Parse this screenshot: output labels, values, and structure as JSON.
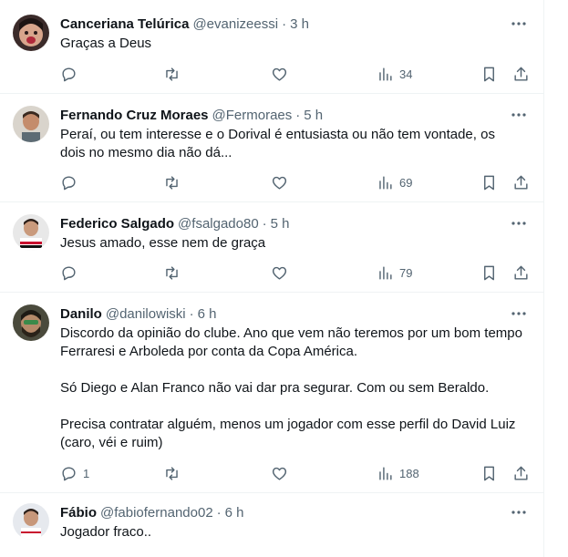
{
  "tweets": [
    {
      "name": "Canceriana Telúrica",
      "handle": "@evanizeessi",
      "separator": "·",
      "time": "3 h",
      "text": [
        "Graças a Deus"
      ],
      "replies": "",
      "views": "34",
      "avatar_icon": "avatar-face-icon"
    },
    {
      "name": "Fernando Cruz Moraes",
      "handle": "@Fermoraes",
      "separator": "·",
      "time": "5 h",
      "text": [
        "Peraí, ou tem interesse e o Dorival é entusiasta ou não tem vontade, os dois no mesmo dia não dá..."
      ],
      "replies": "",
      "views": "69",
      "avatar_icon": "avatar-photo-icon"
    },
    {
      "name": "Federico Salgado",
      "handle": "@fsalgado80",
      "separator": "·",
      "time": "5 h",
      "text": [
        "Jesus amado, esse nem de graça"
      ],
      "replies": "",
      "views": "79",
      "avatar_icon": "avatar-photo-icon"
    },
    {
      "name": "Danilo",
      "handle": "@danilowiski",
      "separator": "·",
      "time": "6 h",
      "text": [
        "Discordo da opinião do clube. Ano que vem não teremos por um bom tempo Ferraresi e Arboleda por conta da Copa América.",
        "",
        "Só Diego e Alan Franco não vai dar pra segurar. Com ou sem Beraldo.",
        "",
        "Precisa contratar alguém, menos um jogador com esse perfil do David Luiz (caro, véi e ruim)"
      ],
      "replies": "1",
      "views": "188",
      "avatar_icon": "avatar-photo-icon"
    },
    {
      "name": "Fábio",
      "handle": "@fabiofernando02",
      "separator": "·",
      "time": "6 h",
      "text": [
        "Jogador fraco.."
      ],
      "replies": "",
      "views": "",
      "avatar_icon": "avatar-photo-icon"
    }
  ],
  "colors": {
    "text_primary": "#0f1419",
    "text_secondary": "#536471",
    "border": "#eff3f4"
  }
}
